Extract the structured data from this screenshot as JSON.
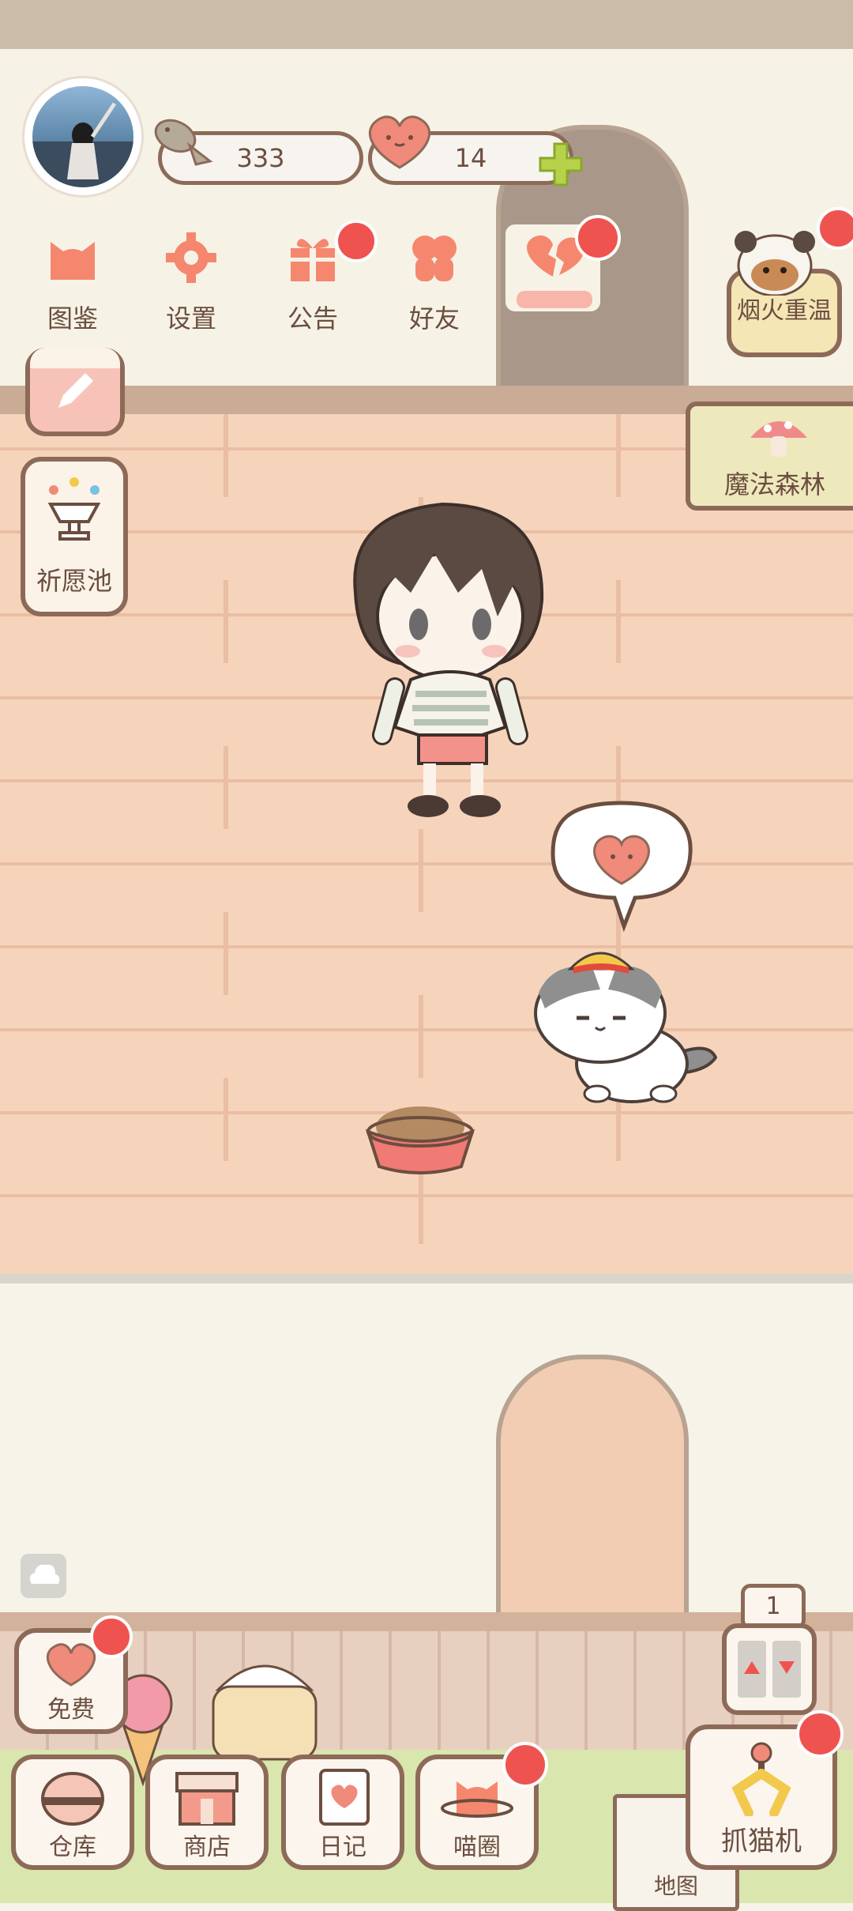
{
  "currency": {
    "fish": "333",
    "hearts": "14"
  },
  "top_menu": [
    {
      "label": "图鉴",
      "icon": "cat-head-icon",
      "badge": false
    },
    {
      "label": "设置",
      "icon": "gear-icon",
      "badge": false
    },
    {
      "label": "公告",
      "icon": "gift-icon",
      "badge": true
    },
    {
      "label": "好友",
      "icon": "friends-icon",
      "badge": false
    }
  ],
  "side_left": {
    "diary_icon": "calendar-pencil-icon",
    "wish_label": "祈愿池"
  },
  "side_right": {
    "event_label": "烟火重温",
    "forest_label": "魔法森林"
  },
  "bottom_left": {
    "free_label": "免费"
  },
  "bottom_bar": [
    {
      "label": "仓库",
      "icon": "storage-icon"
    },
    {
      "label": "商店",
      "icon": "shop-icon"
    },
    {
      "label": "日记",
      "icon": "notebook-icon"
    },
    {
      "label": "喵圈",
      "icon": "cat-planet-icon"
    }
  ],
  "elevator": {
    "floor": "1"
  },
  "claw": {
    "label": "抓猫机"
  },
  "map": {
    "label": "地图"
  },
  "colors": {
    "accent_red": "#ef5350",
    "outline_brown": "#8d6a58",
    "floor": "#f6d4bb",
    "heart": "#f08a7a"
  }
}
